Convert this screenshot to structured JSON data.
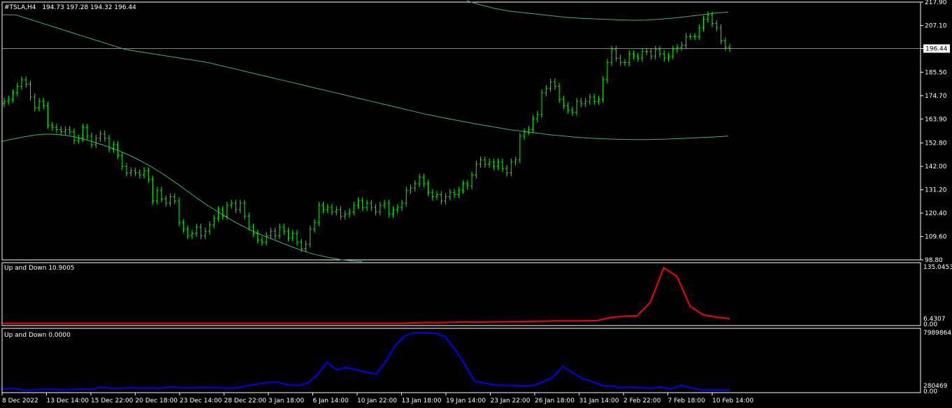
{
  "chart_header": {
    "symbol_tf": "#TSLA,H4",
    "ohlc": "194.73 197.28 194.32 196.44"
  },
  "colors": {
    "background": "#000000",
    "frame": "#ffffff",
    "bars": "#00ff00",
    "envelope": "#3cb371",
    "price_line": "#778899",
    "up_line": "#ff0000",
    "down_line": "#0000ff"
  },
  "chart_data": [
    {
      "type": "line",
      "panel": "main",
      "title": "#TSLA,H4 194.73 197.28 194.32 196.44",
      "ylim": [
        98.8,
        217.9
      ],
      "y_ticks": [
        "217.90",
        "207.10",
        "196.44",
        "185.50",
        "174.70",
        "163.90",
        "152.80",
        "142.00",
        "131.20",
        "120.40",
        "109.60",
        "98.80"
      ],
      "current_price": 196.44,
      "bars": {
        "name": "",
        "closes": [
          172,
          173,
          176,
          179,
          182,
          180,
          174,
          169,
          172,
          170,
          161,
          160,
          159,
          158,
          159,
          158,
          154,
          155,
          160,
          156,
          152,
          155,
          157,
          155,
          150,
          152,
          147,
          142,
          139,
          140,
          139,
          138,
          140,
          136,
          126,
          131,
          127,
          125,
          128,
          126,
          116,
          113,
          110,
          111,
          114,
          110,
          112,
          115,
          118,
          122,
          119,
          124,
          125,
          122,
          125,
          119,
          114,
          111,
          108,
          107,
          110,
          112,
          110,
          114,
          112,
          109,
          111,
          107,
          104,
          106,
          113,
          116,
          124,
          122,
          123,
          121,
          122,
          119,
          120,
          121,
          124,
          126,
          123,
          125,
          123,
          121,
          124,
          125,
          120,
          122,
          123,
          125,
          131,
          132,
          134,
          137,
          134,
          130,
          128,
          129,
          126,
          128,
          130,
          129,
          131,
          134,
          133,
          138,
          143,
          145,
          143,
          144,
          142,
          144,
          141,
          139,
          144,
          145,
          156,
          158,
          159,
          164,
          166,
          176,
          178,
          181,
          179,
          173,
          170,
          168,
          167,
          172,
          171,
          172,
          174,
          172,
          173,
          182,
          190,
          196,
          192,
          190,
          190,
          194,
          193,
          192,
          195,
          195,
          193,
          196,
          194,
          192,
          193,
          196,
          197,
          198,
          202,
          202,
          202,
          206,
          210,
          212,
          208,
          206,
          200,
          197,
          196.44
        ]
      },
      "series": [
        {
          "name": "",
          "values": [
            212,
            212,
            210,
            208,
            206,
            204,
            202,
            200,
            198,
            196,
            195,
            194,
            193,
            192,
            191,
            190,
            188.5,
            187,
            185.5,
            184,
            182.5,
            181,
            179.5,
            178,
            176.5,
            175,
            173.5,
            172,
            170.5,
            169,
            167.5,
            166,
            164.7,
            163.5,
            162.3,
            161.2,
            160.1,
            159,
            158.2,
            157.4,
            156.6,
            156,
            155.4,
            155,
            154.7,
            154.5,
            154.4,
            154.4,
            154.5,
            154.7,
            155,
            155.3,
            155.6,
            156
          ]
        },
        {
          "name": "",
          "values": [
            153.5,
            154.3,
            154.9,
            155.6,
            156.1,
            156.6,
            156.9,
            156.9,
            156.7,
            156.3,
            155.8,
            155.1,
            154.2,
            153.2,
            152.2,
            151.1,
            149.9,
            148.6,
            147.2,
            145.6,
            143.9,
            142.1,
            140.1,
            138,
            135.8,
            133.6,
            131.2,
            128.8,
            126.5,
            124.2,
            122.2,
            120.2,
            118.2,
            116.3,
            114.6,
            112.9,
            111.4,
            110,
            108.7,
            107.5,
            106.2,
            104.9,
            103.7,
            102.6,
            101.6,
            100.8,
            100.1,
            99.5,
            98.9,
            98.5,
            98.2,
            98.1
          ]
        },
        {
          "name": "",
          "values": [
            218.5,
            216.6,
            215,
            213.8,
            213.1,
            212.4,
            211.7,
            211,
            210.5,
            210.2,
            210,
            209.7,
            209.5,
            209.6,
            210,
            210.5,
            211.2,
            212,
            212.8,
            213.3
          ]
        }
      ]
    },
    {
      "type": "line",
      "panel": "up",
      "title": "Up and Down 10.9005",
      "ylim": [
        0,
        135.0453
      ],
      "y_ticks": [
        "135.0453",
        "6.4307",
        "0.00"
      ],
      "series": [
        {
          "name": "",
          "values": [
            0.5,
            0.5,
            0.5,
            0.5,
            0.5,
            0.5,
            0.5,
            0.5,
            0.5,
            0.5,
            0.5,
            0.5,
            0.5,
            0.5,
            0.5,
            0.5,
            0.5,
            0.5,
            0.5,
            0.5,
            0.5,
            0.5,
            0.5,
            0.5,
            0.5,
            0.5,
            0.5,
            0.5,
            0.5,
            0.5,
            0.5,
            1.5,
            2.5,
            2,
            3,
            3.5,
            3,
            4,
            4,
            4.5,
            5,
            5.5,
            6,
            6,
            6,
            7,
            14,
            17,
            18,
            50,
            130,
            110,
            40,
            20,
            15,
            10.9
          ]
        }
      ]
    },
    {
      "type": "line",
      "panel": "down",
      "title": "Up and Down 0.0000",
      "ylim": [
        0,
        7989864
      ],
      "y_ticks": [
        "7989864",
        "280469",
        "0.00"
      ],
      "series": [
        {
          "name": "",
          "values": [
            200000,
            300000,
            100000,
            100000,
            150000,
            200000,
            100000,
            150000,
            200000,
            150000,
            500000,
            300000,
            300000,
            400000,
            300000,
            350000,
            300000,
            500000,
            400000,
            350000,
            450000,
            450000,
            400000,
            300000,
            400000,
            700000,
            900000,
            1100000,
            1100000,
            800000,
            700000,
            1000000,
            2100000,
            3800000,
            2800000,
            3100000,
            2800000,
            2500000,
            2200000,
            4000000,
            6200000,
            7400000,
            7800000,
            7800000,
            7700000,
            7300000,
            5600000,
            3600000,
            1300000,
            1000000,
            800000,
            700000,
            700000,
            650000,
            700000,
            1200000,
            1800000,
            3300000,
            2400000,
            1600000,
            1200000,
            700000,
            600000,
            400000,
            500000,
            400000,
            300000,
            500000,
            200000,
            700000,
            400000,
            100000,
            100000,
            100000,
            100000
          ]
        }
      ]
    }
  ],
  "time_axis": {
    "labels": [
      "8 Dec 2022",
      "13 Dec 14:00",
      "15 Dec 22:00",
      "20 Dec 18:00",
      "23 Dec 14:00",
      "28 Dec 22:00",
      "3 Jan 18:00",
      "6 Jan 14:00",
      "10 Jan 22:00",
      "13 Jan 18:00",
      "19 Jan 14:00",
      "23 Jan 22:00",
      "26 Jan 18:00",
      "31 Jan 14:00",
      "2 Feb 22:00",
      "7 Feb 18:00",
      "10 Feb 14:00"
    ]
  }
}
